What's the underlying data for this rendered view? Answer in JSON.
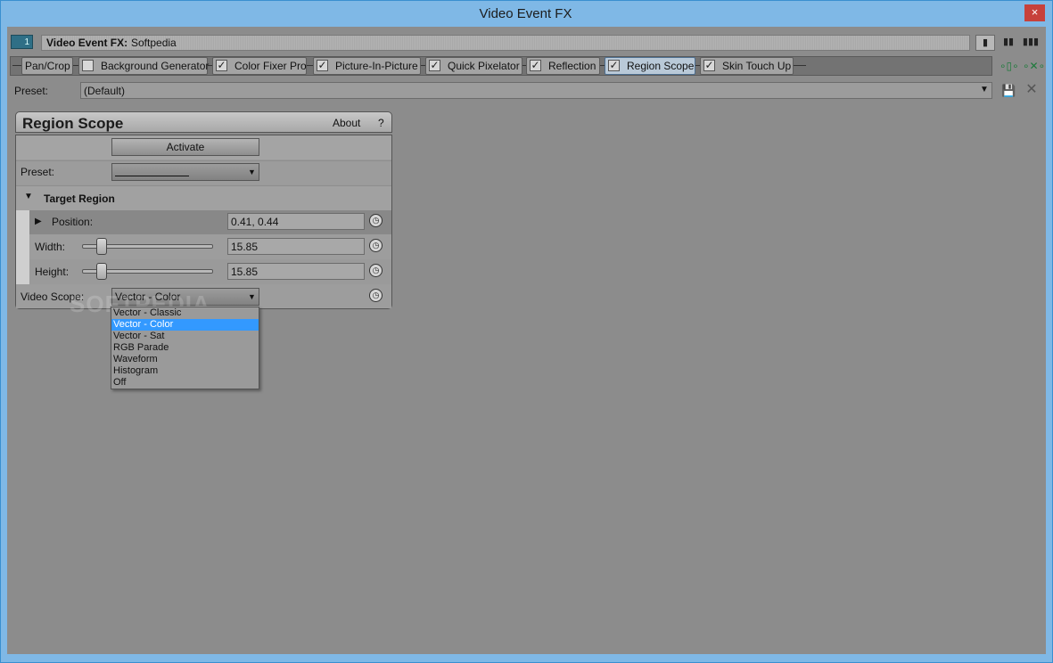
{
  "window": {
    "title": "Video Event FX",
    "close_glyph": "×"
  },
  "header": {
    "badge_number": "1",
    "label": "Video Event FX:",
    "value": "Softpedia",
    "view_buttons": [
      "single-column-icon",
      "double-column-icon",
      "triple-column-icon"
    ]
  },
  "fx_chain": {
    "tabs": [
      {
        "label": "Pan/Crop",
        "checkbox": false,
        "checked": false,
        "active": false
      },
      {
        "label": "Background Generator",
        "checkbox": true,
        "checked": false,
        "active": false
      },
      {
        "label": "Color Fixer Pro",
        "checkbox": true,
        "checked": true,
        "active": false
      },
      {
        "label": "Picture-In-Picture",
        "checkbox": true,
        "checked": true,
        "active": false
      },
      {
        "label": "Quick Pixelator",
        "checkbox": true,
        "checked": true,
        "active": false
      },
      {
        "label": "Reflection",
        "checkbox": true,
        "checked": true,
        "active": false
      },
      {
        "label": "Region Scope",
        "checkbox": true,
        "checked": true,
        "active": true
      },
      {
        "label": "Skin Touch Up",
        "checkbox": true,
        "checked": true,
        "active": false
      }
    ]
  },
  "preset": {
    "label": "Preset:",
    "value": "(Default)"
  },
  "plugin": {
    "title": "Region Scope",
    "about": "About",
    "help": "?",
    "activate_label": "Activate",
    "preset_label": "Preset:",
    "target_region_label": "Target Region",
    "position_label": "Position:",
    "position_value": "0.41, 0.44",
    "width_label": "Width:",
    "width_value": "15.85",
    "height_label": "Height:",
    "height_value": "15.85",
    "video_scope_label": "Video Scope:",
    "video_scope_value": "Vector - Color",
    "video_scope_options": [
      "Vector - Classic",
      "Vector - Color",
      "Vector - Sat",
      "RGB Parade",
      "Waveform",
      "Histogram",
      "Off"
    ],
    "video_scope_selected_index": 1
  },
  "watermark": "SOFTPEDIA",
  "colors": {
    "accent_frame": "#7fb8e6",
    "selection": "#3399ff",
    "close": "#c7413b"
  }
}
